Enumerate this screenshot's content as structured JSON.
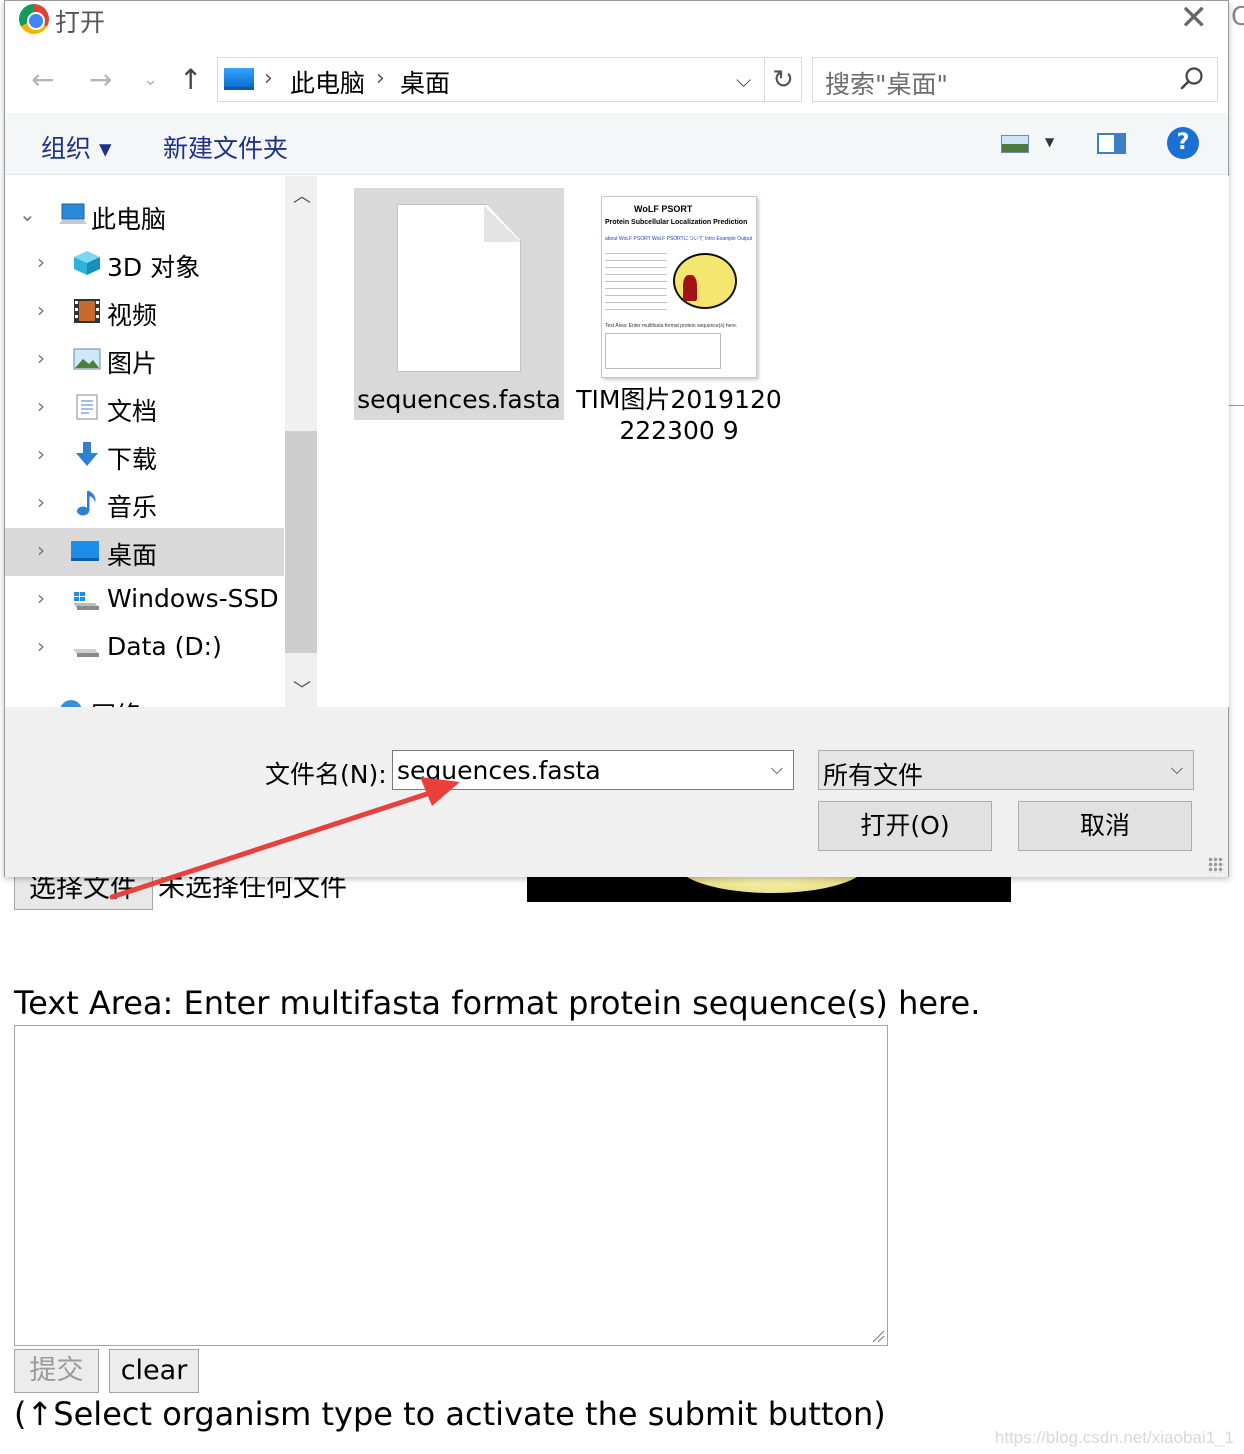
{
  "dialog": {
    "title": "打开",
    "address": {
      "crumbs": [
        "此电脑",
        "桌面"
      ]
    },
    "search_placeholder": "搜索\"桌面\"",
    "toolbar": {
      "organize": "组织 ▾",
      "new_folder": "新建文件夹",
      "help": "?"
    },
    "nav_tree": [
      {
        "label": "此电脑",
        "icon": "computer-icon",
        "expanded": true
      },
      {
        "label": "3D 对象",
        "icon": "3d-objects-icon"
      },
      {
        "label": "视频",
        "icon": "video-icon"
      },
      {
        "label": "图片",
        "icon": "pictures-icon"
      },
      {
        "label": "文档",
        "icon": "documents-icon"
      },
      {
        "label": "下载",
        "icon": "download-icon"
      },
      {
        "label": "音乐",
        "icon": "music-icon"
      },
      {
        "label": "桌面",
        "icon": "desktop-icon",
        "selected": true
      },
      {
        "label": "Windows-SSD (",
        "icon": "windows-drive-icon"
      },
      {
        "label": "Data (D:)",
        "icon": "drive-icon"
      },
      {
        "label": "网络",
        "icon": "network-icon"
      }
    ],
    "files": [
      {
        "name": "sequences.fasta",
        "type": "document",
        "selected": true
      },
      {
        "name": "TIM图片2019120222300 9",
        "type": "image"
      }
    ],
    "thumbnail": {
      "title": "WoLF PSORT",
      "subtitle": "Protein Subcellular Localization Prediction",
      "links": "about WoLF PSORT  WoLF PSORTについて  Intro  Example Output",
      "logo_text": "wolf PSORT",
      "textarea_label": "Text Area: Enter multifasta format protein sequence(s) here."
    },
    "filename_label": "文件名(N):",
    "filename_value": "sequences.fasta",
    "filter_value": "所有文件",
    "open_button": "打开(O)",
    "cancel_button": "取消"
  },
  "page": {
    "choose_file_button": "选择文件",
    "no_file_text": "未选择任何文件",
    "text_area_label": "Text Area: Enter multifasta format protein sequence(s) here.",
    "submit_button": "提交",
    "clear_button": "clear",
    "hint": "(↑Select organism type to activate the submit button)",
    "watermark": "https://blog.csdn.net/xiaobai1_1"
  },
  "colors": {
    "annotation_arrow": "#e8403a",
    "link_blue": "#1e3287",
    "selection_gray": "#d9d9d9"
  }
}
